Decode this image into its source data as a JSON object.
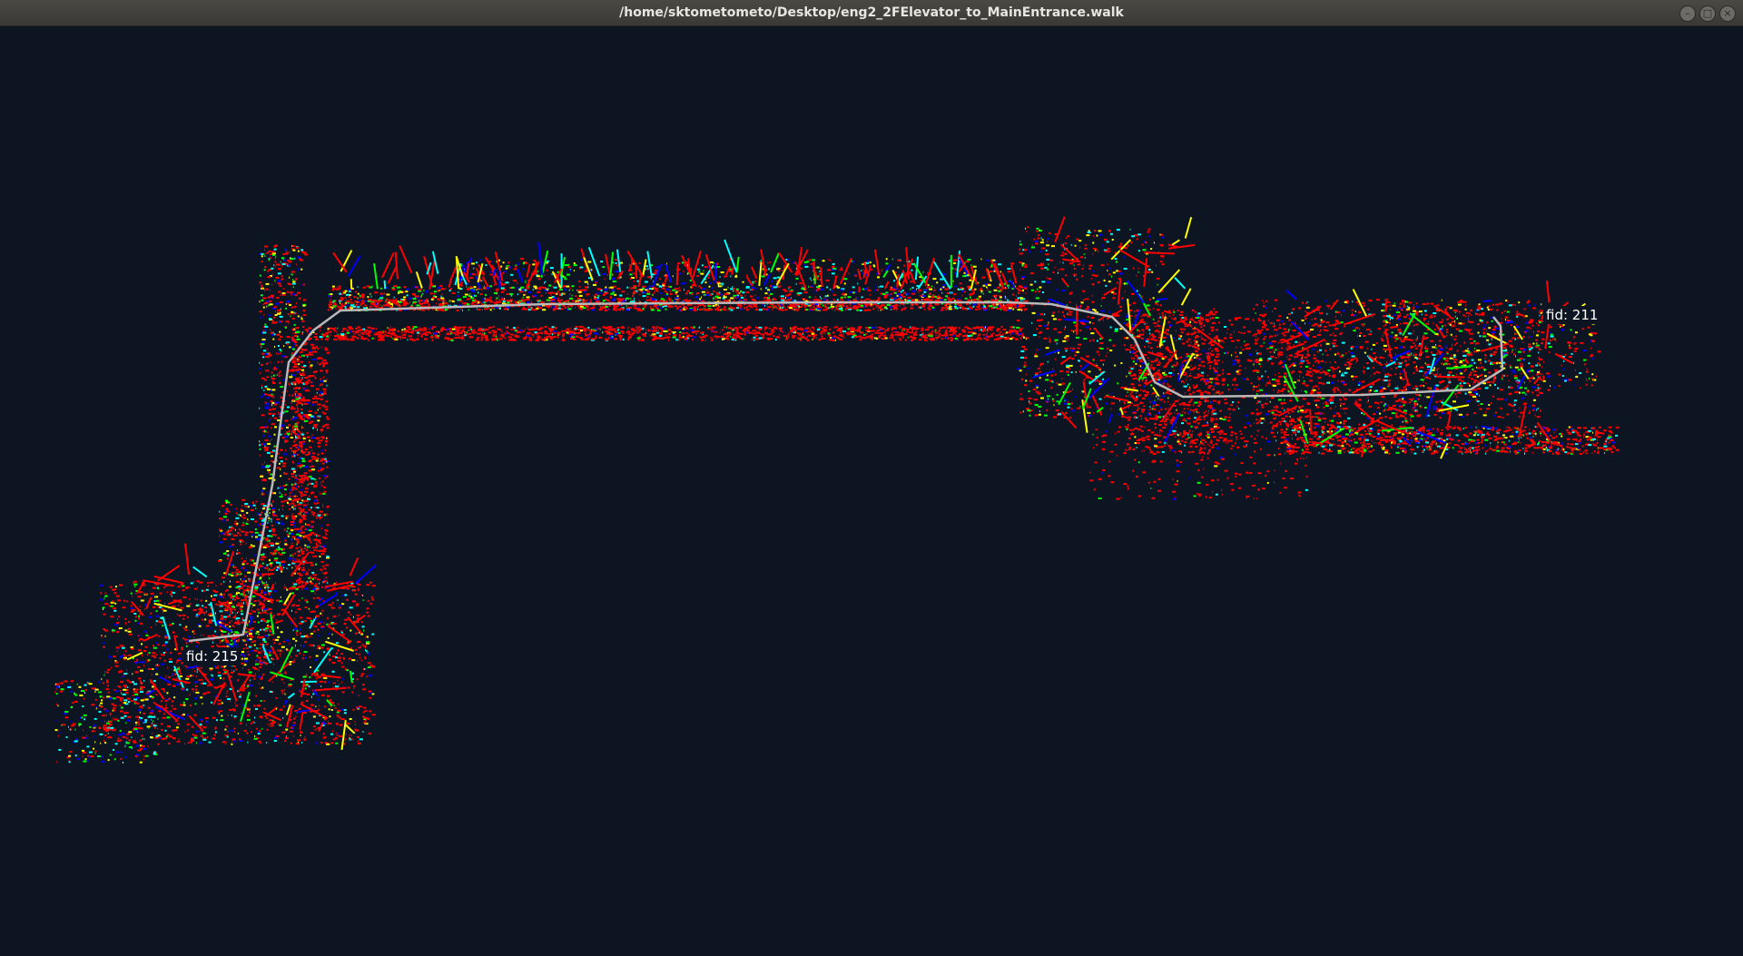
{
  "window": {
    "title": "/home/sktometometo/Desktop/eng2_2FElevator_to_MainEntrance.walk",
    "controls": [
      {
        "name": "minimize",
        "glyph": "–"
      },
      {
        "name": "maximize",
        "glyph": "□"
      },
      {
        "name": "close",
        "glyph": "×"
      }
    ]
  },
  "viewer": {
    "background": "#0c1521",
    "path_color": "#b9b9b9",
    "point_colors": [
      "#ff0000",
      "#ffff00",
      "#00ff00",
      "#00ffff",
      "#0000ff"
    ],
    "fiducials": [
      {
        "label": "fid: 215",
        "color": "#ffffff"
      },
      {
        "label": "fid: 211",
        "color": "#ffffff"
      }
    ]
  }
}
